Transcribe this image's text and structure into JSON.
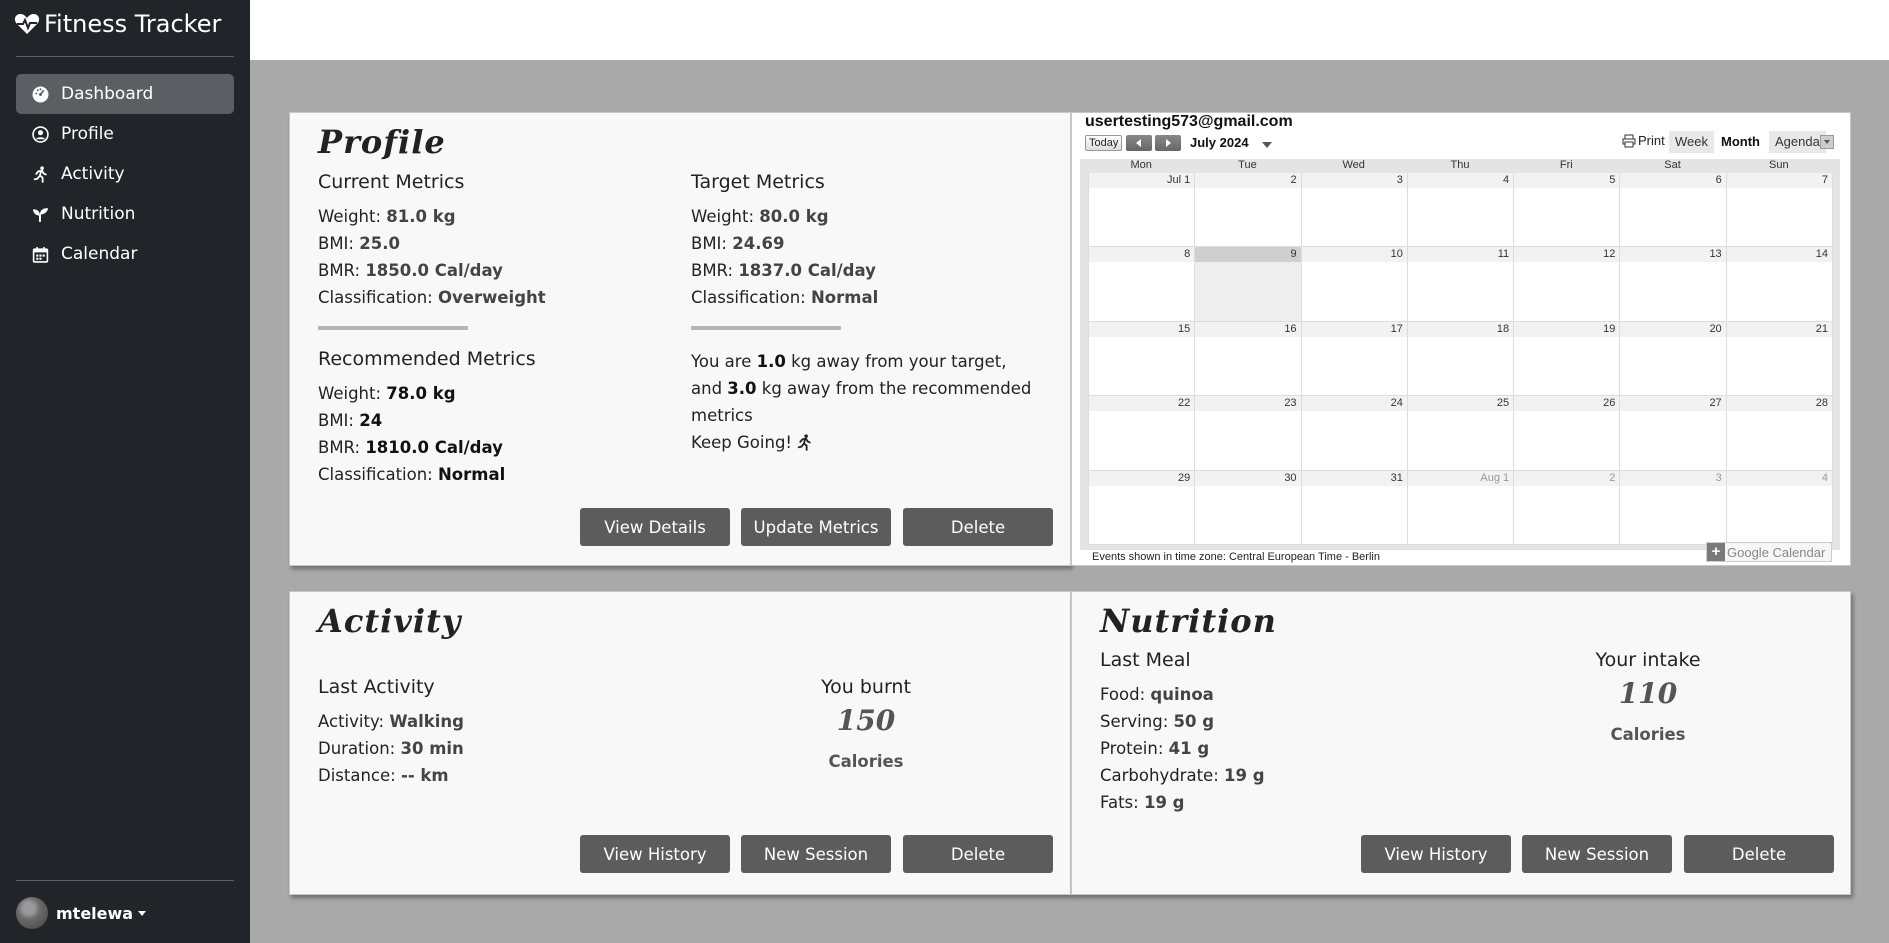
{
  "app": {
    "title": "Fitness Tracker"
  },
  "sidebar": {
    "items": [
      {
        "label": "Dashboard",
        "icon": "dashboard-icon"
      },
      {
        "label": "Profile",
        "icon": "user-circle-icon"
      },
      {
        "label": "Activity",
        "icon": "running-icon"
      },
      {
        "label": "Nutrition",
        "icon": "seedling-icon"
      },
      {
        "label": "Calendar",
        "icon": "calendar-icon"
      }
    ],
    "user": "mtelewa"
  },
  "profile": {
    "title": "Profile",
    "current": {
      "heading": "Current Metrics",
      "weight_label": "Weight:",
      "weight": "81.0 kg",
      "bmi_label": "BMI:",
      "bmi": "25.0",
      "bmr_label": "BMR:",
      "bmr": "1850.0 Cal/day",
      "class_label": "Classification:",
      "class": "Overweight"
    },
    "target": {
      "heading": "Target Metrics",
      "weight_label": "Weight:",
      "weight": "80.0 kg",
      "bmi_label": "BMI:",
      "bmi": "24.69",
      "bmr_label": "BMR:",
      "bmr": "1837.0 Cal/day",
      "class_label": "Classification:",
      "class": "Normal"
    },
    "recommended": {
      "heading": "Recommended Metrics",
      "weight_label": "Weight:",
      "weight": "78.0 kg",
      "bmi_label": "BMI:",
      "bmi": "24",
      "bmr_label": "BMR:",
      "bmr": "1810.0 Cal/day",
      "class_label": "Classification:",
      "class": "Normal"
    },
    "message": {
      "p1": "You are",
      "v1": "1.0",
      "p2": "kg away from your target,",
      "p3": "and",
      "v2": "3.0",
      "p4": "kg away from the recommended",
      "p5": "metrics",
      "keep": "Keep Going!"
    },
    "buttons": {
      "details": "View Details",
      "update": "Update Metrics",
      "delete": "Delete"
    }
  },
  "calendar": {
    "email": "usertesting573@gmail.com",
    "today": "Today",
    "month": "July 2024",
    "print": "Print",
    "views": [
      "Week",
      "Month",
      "Agenda"
    ],
    "days_of_week": [
      "Mon",
      "Tue",
      "Wed",
      "Thu",
      "Fri",
      "Sat",
      "Sun"
    ],
    "weeks": [
      [
        "Jul 1",
        "2",
        "3",
        "4",
        "5",
        "6",
        "7"
      ],
      [
        "8",
        "9",
        "10",
        "11",
        "12",
        "13",
        "14"
      ],
      [
        "15",
        "16",
        "17",
        "18",
        "19",
        "20",
        "21"
      ],
      [
        "22",
        "23",
        "24",
        "25",
        "26",
        "27",
        "28"
      ],
      [
        "29",
        "30",
        "31",
        "Aug 1",
        "2",
        "3",
        "4"
      ]
    ],
    "footer": "Events shown in time zone: Central European Time - Berlin",
    "brand": "Google Calendar"
  },
  "activity": {
    "title": "Activity",
    "heading": "Last Activity",
    "activity_label": "Activity:",
    "activity": "Walking",
    "duration_label": "Duration:",
    "duration": "30 min",
    "distance_label": "Distance:",
    "distance": "-- km",
    "burnt_heading": "You burnt",
    "burnt_value": "150",
    "burnt_unit": "Calories",
    "buttons": {
      "history": "View History",
      "new": "New Session",
      "delete": "Delete"
    }
  },
  "nutrition": {
    "title": "Nutrition",
    "heading": "Last Meal",
    "food_label": "Food:",
    "food": "quinoa",
    "serving_label": "Serving:",
    "serving": "50 g",
    "protein_label": "Protein:",
    "protein": "41 g",
    "carb_label": "Carbohydrate:",
    "carb": "19 g",
    "fats_label": "Fats:",
    "fats": "19 g",
    "intake_heading": "Your intake",
    "intake_value": "110",
    "intake_unit": "Calories",
    "buttons": {
      "history": "View History",
      "new": "New Session",
      "delete": "Delete"
    }
  }
}
